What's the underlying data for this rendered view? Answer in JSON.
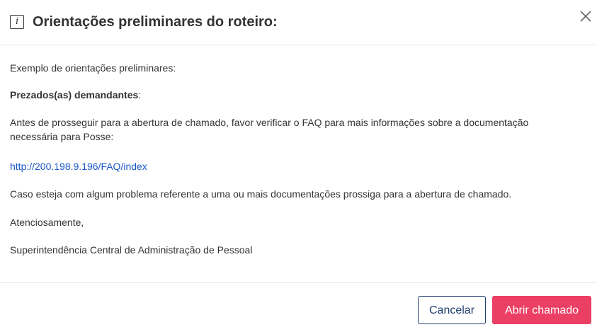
{
  "dialog": {
    "title": "Orientações preliminares do roteiro:",
    "info_icon_glyph": "i",
    "icons": {
      "title": "info-icon",
      "close": "close-icon"
    }
  },
  "content": {
    "intro": "Exemplo de orientações preliminares:",
    "greeting_bold": "Prezados(as) demandantes",
    "greeting_suffix": ":",
    "paragraph_faq": "Antes de prosseguir para a abertura de chamado, favor verificar o FAQ para mais informações sobre a documentação necessária para Posse:",
    "faq_link": "http://200.198.9.196/FAQ/index",
    "paragraph_problem": "Caso esteja com algum problema referente a uma ou mais documentações prossiga para a abertura de chamado.",
    "closing": "Atenciosamente,",
    "signature": "Superintendência Central de Administração de Pessoal"
  },
  "footer": {
    "cancel_label": "Cancelar",
    "open_ticket_label": "Abrir chamado"
  },
  "colors": {
    "primary_button": "#ec3f64",
    "cancel_border": "#1f3e6e",
    "link": "#1a56c7",
    "text": "#333333"
  }
}
